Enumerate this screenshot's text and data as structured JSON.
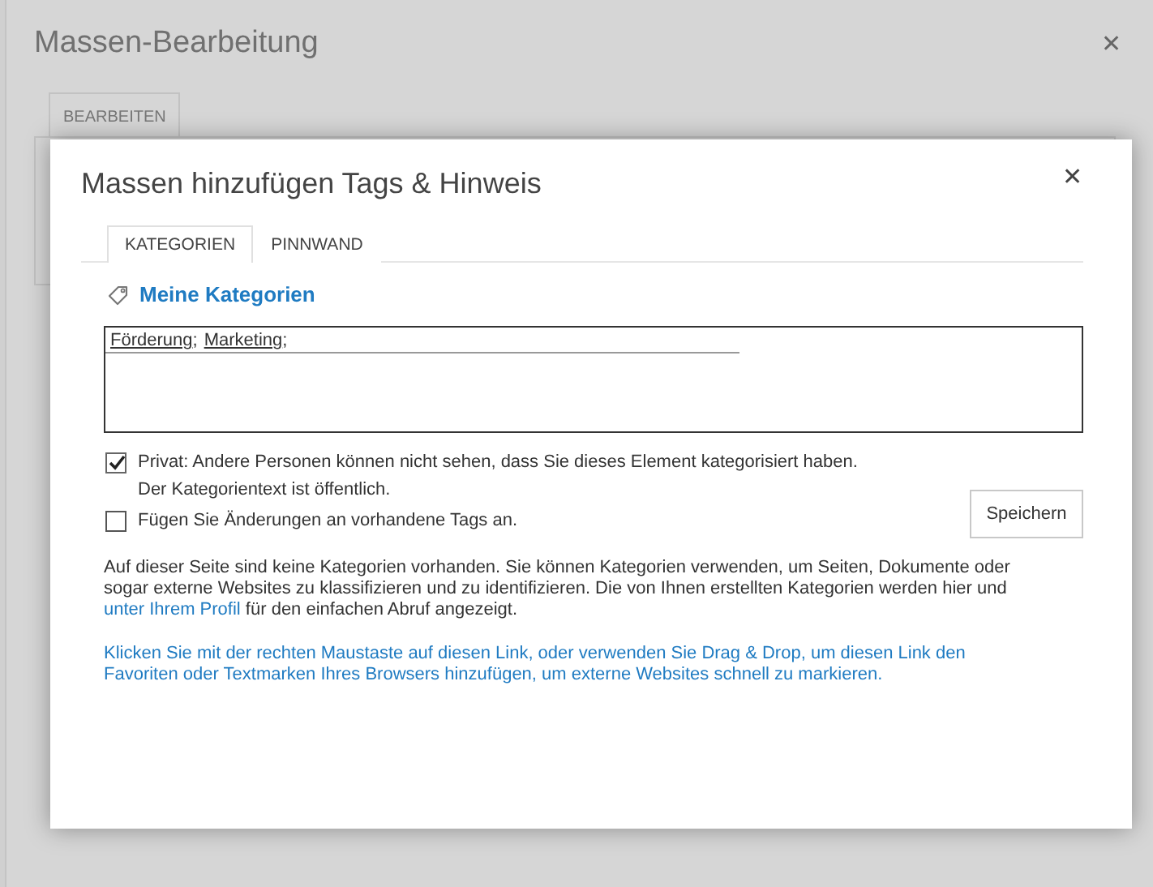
{
  "background_dialog": {
    "title": "Massen-Bearbeitung",
    "close": "✕",
    "tab": "BEARBEITEN"
  },
  "dialog": {
    "title": "Massen hinzufügen Tags & Hinweis",
    "close": "✕",
    "tabs": [
      {
        "label": "KATEGORIEN",
        "selected": true
      },
      {
        "label": "PINNWAND",
        "selected": false
      }
    ],
    "section_title": "Meine Kategorien",
    "tags_field": {
      "tags": [
        "Förderung",
        "Marketing"
      ],
      "separator": ";"
    },
    "checkboxes": [
      {
        "label": "Privat: Andere Personen können nicht sehen, dass Sie dieses Element kategorisiert haben. Der Kategorientext ist öffentlich.",
        "checked": true
      },
      {
        "label": "Fügen Sie Änderungen an vorhandene Tags an.",
        "checked": false
      }
    ],
    "save_button": "Speichern",
    "description": {
      "before": "Auf dieser Seite sind keine Kategorien vorhanden. Sie können Kategorien verwenden, um Seiten, Dokumente oder sogar externe Websites zu klassifizieren und zu identifizieren. Die von Ihnen erstellten Kategorien werden hier und ",
      "link": "unter Ihrem Profil",
      "after": " für den einfachen Abruf angezeigt."
    },
    "bookmark_link": "Klicken Sie mit der rechten Maustaste auf diesen Link, oder verwenden Sie Drag & Drop, um diesen Link den Favoriten oder Textmarken Ihres Browsers hinzufügen, um externe Websites schnell zu markieren."
  }
}
